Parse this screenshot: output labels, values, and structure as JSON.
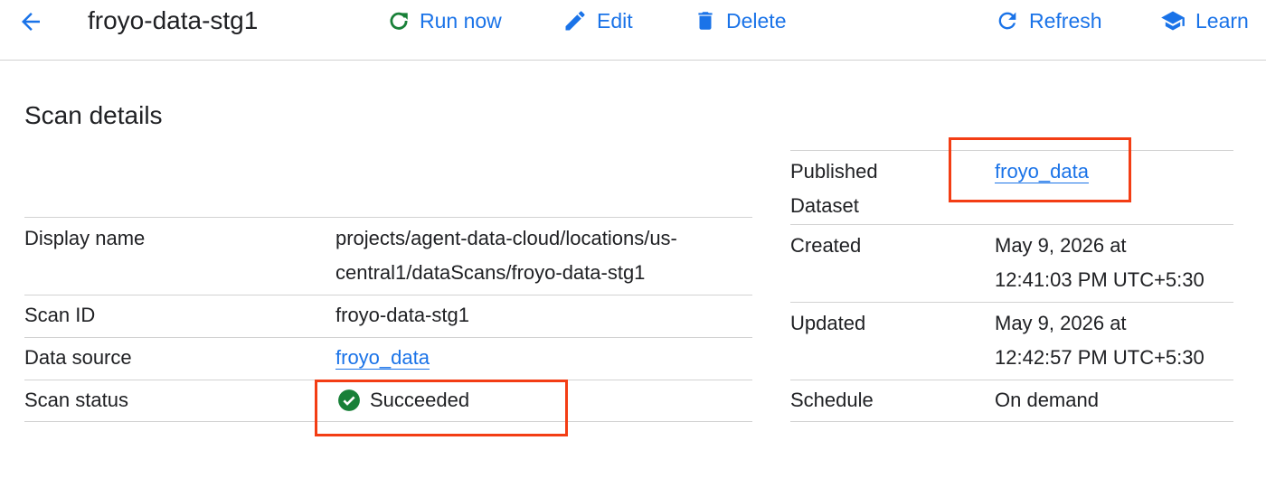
{
  "header": {
    "title": "froyo-data-stg1",
    "actions": {
      "run_now": "Run now",
      "edit": "Edit",
      "delete": "Delete",
      "refresh": "Refresh",
      "learn": "Learn"
    }
  },
  "scan_details": {
    "heading": "Scan details",
    "left": {
      "display_name_label": "Display name",
      "display_name_line1": "projects/agent-data-cloud/locations/us-",
      "display_name_line2": "central1/dataScans/froyo-data-stg1",
      "scan_id_label": "Scan ID",
      "scan_id": "froyo-data-stg1",
      "data_source_label": "Data source",
      "data_source": "froyo_data",
      "scan_status_label": "Scan status",
      "scan_status": "Succeeded"
    },
    "right": {
      "published_label_line1": "Published",
      "published_label_line2": "Dataset",
      "published_dataset": "froyo_data",
      "created_label": "Created",
      "created_line1": "May 9, 2026 at",
      "created_line2": "12:41:03 PM UTC+5:30",
      "updated_label": "Updated",
      "updated_line1": "May 9, 2026 at",
      "updated_line2": "12:42:57 PM UTC+5:30",
      "schedule_label": "Schedule",
      "schedule": "On demand"
    }
  },
  "colors": {
    "link": "#1a73e8",
    "success": "#188038",
    "highlight": "#f33d14"
  },
  "icons": [
    "arrow-back-icon",
    "refresh-icon",
    "edit-icon",
    "delete-icon",
    "learn-icon",
    "check-circle-icon"
  ]
}
